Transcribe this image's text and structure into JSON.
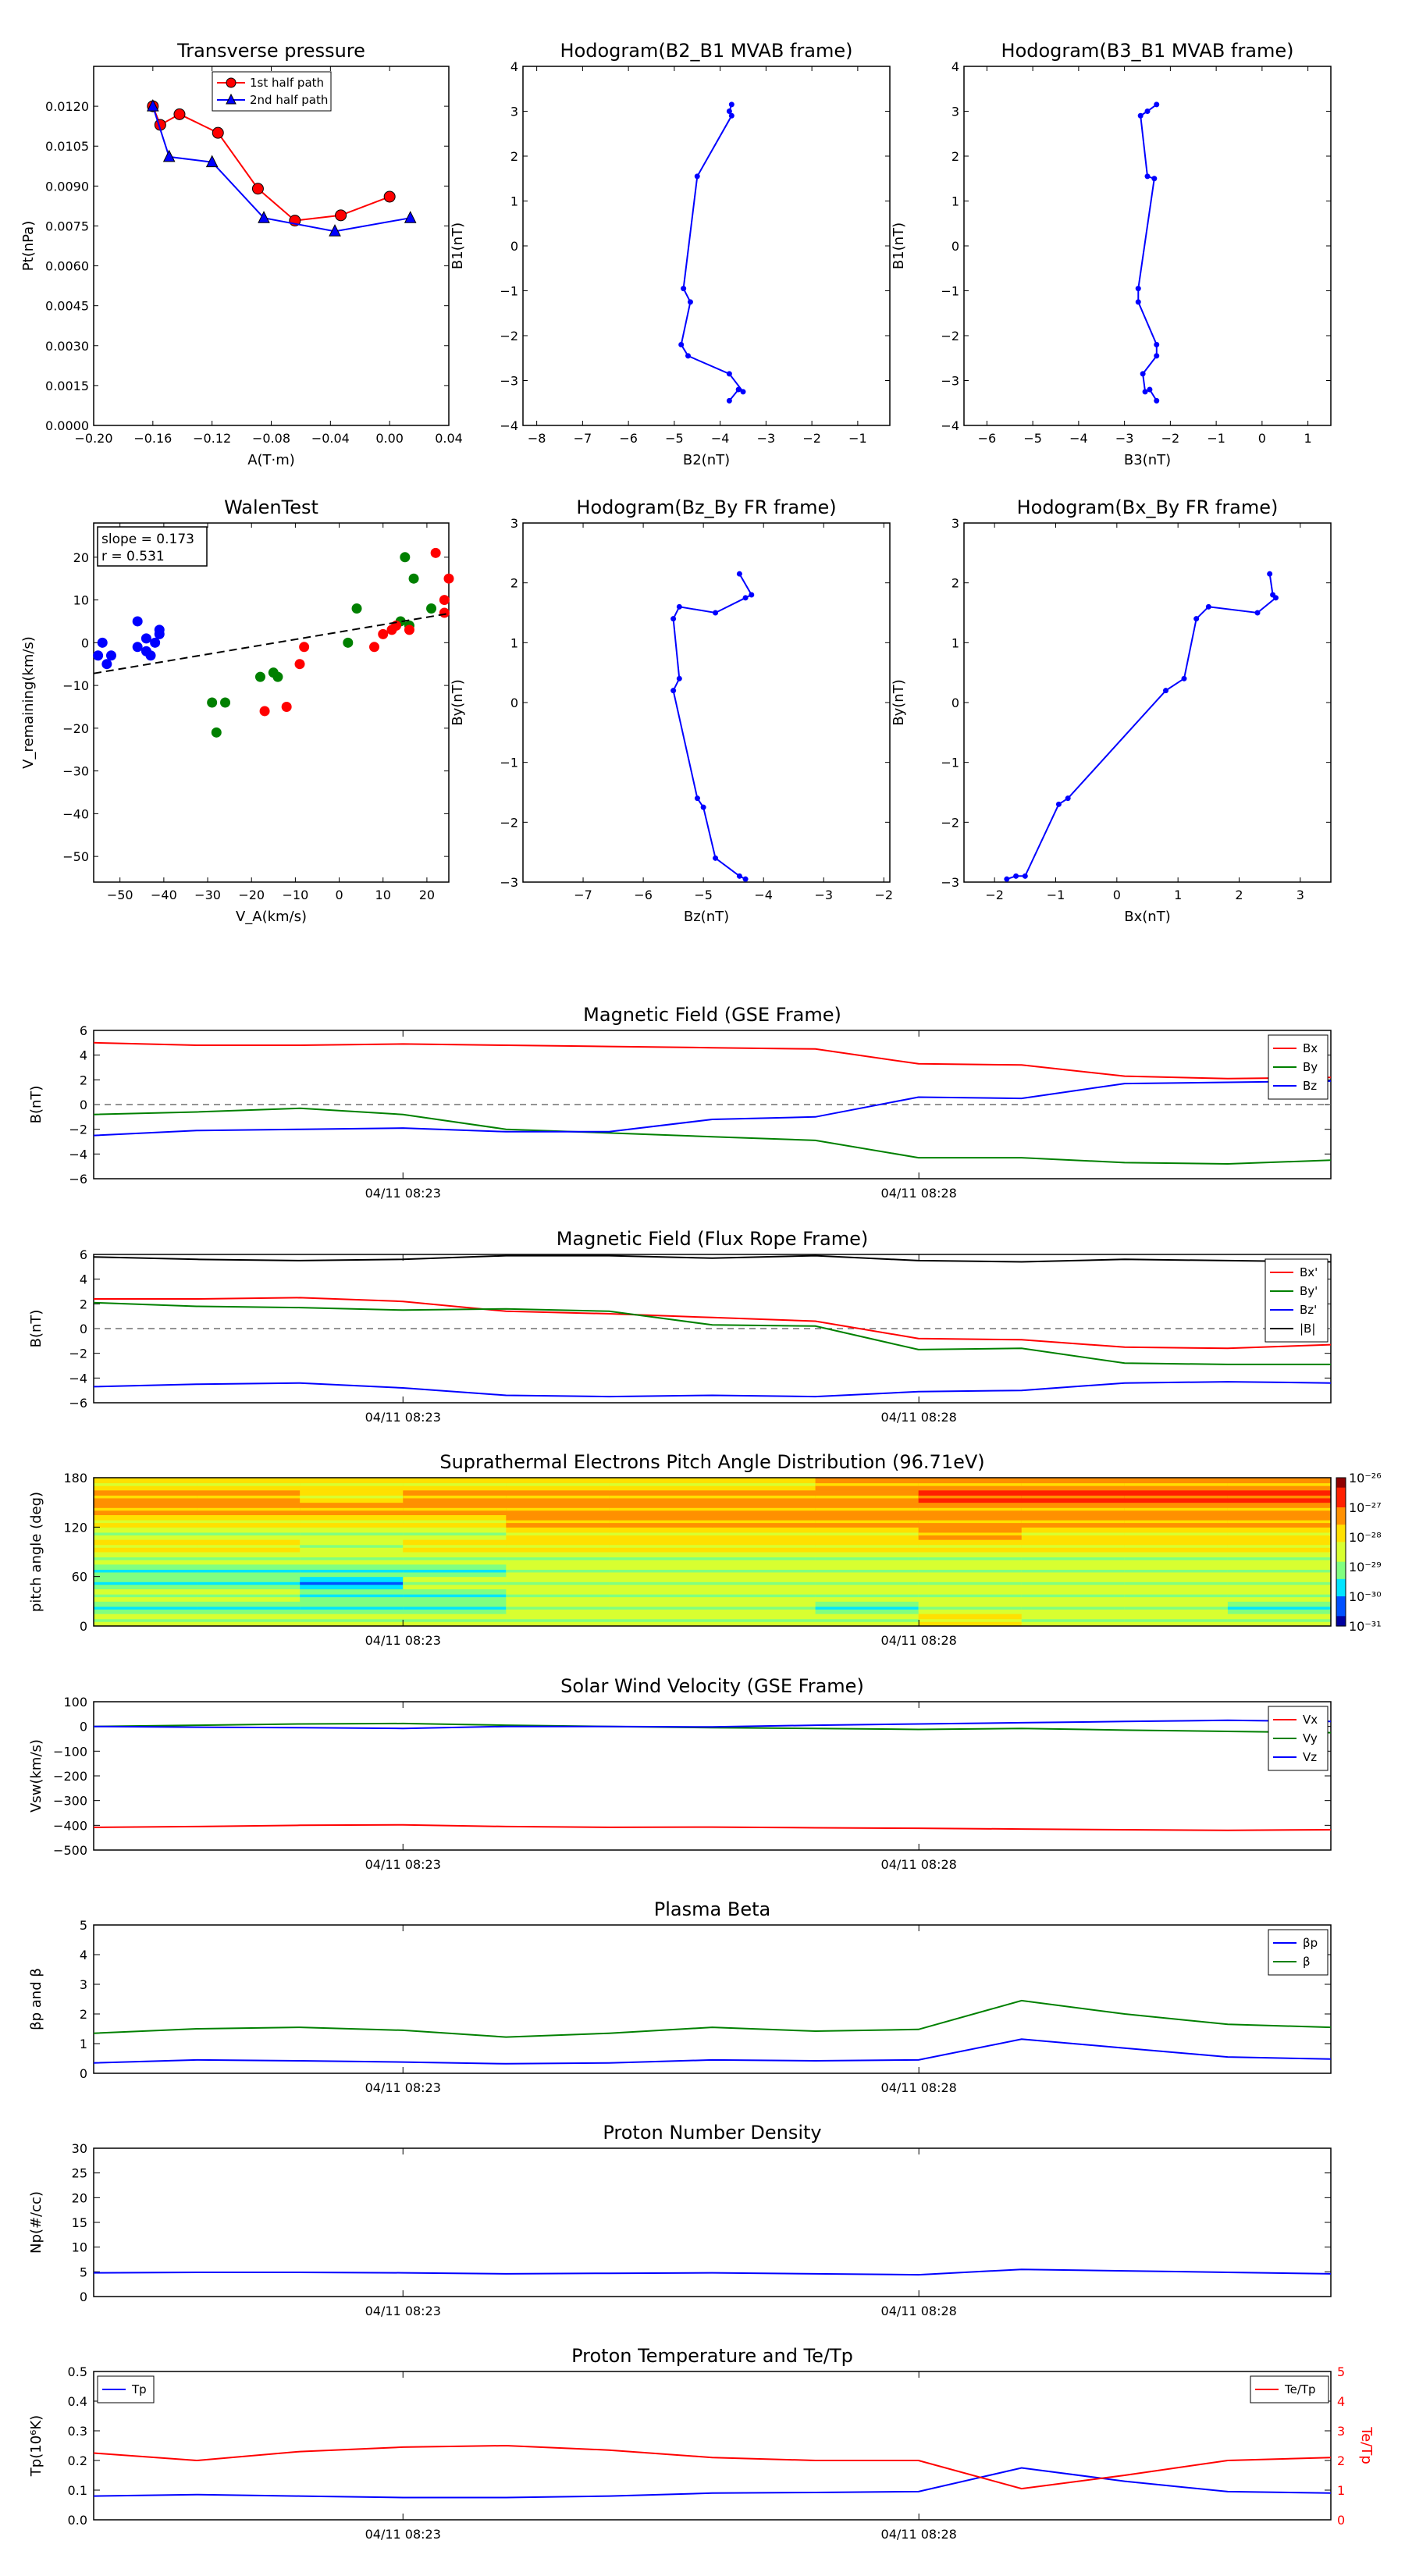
{
  "charts": {
    "transverse_pressure": {
      "type": "line",
      "title": "Transverse pressure",
      "xlabel": "A(T·m)",
      "ylabel": "Pt(nPa)",
      "xlim": [
        -0.2,
        0.04
      ],
      "ylim": [
        0,
        0.0135
      ],
      "xticks": [
        "−0.20",
        "−0.16",
        "−0.12",
        "−0.08",
        "−0.04",
        "0.00",
        "0.04"
      ],
      "yticks": [
        "0.0000",
        "0.0015",
        "0.0030",
        "0.0045",
        "0.0060",
        "0.0075",
        "0.0090",
        "0.0105",
        "0.0120"
      ],
      "legend": "top-center",
      "series": [
        {
          "name": "1st half path",
          "color": "#ff0000",
          "marker": "circle",
          "x": [
            -0.16,
            -0.155,
            -0.142,
            -0.116,
            -0.089,
            -0.064,
            -0.033,
            0.0
          ],
          "y": [
            0.012,
            0.0113,
            0.0117,
            0.011,
            0.0089,
            0.0077,
            0.0079,
            0.0086
          ]
        },
        {
          "name": "2nd half path",
          "color": "#0000ff",
          "marker": "triangle",
          "x": [
            -0.16,
            -0.149,
            -0.12,
            -0.085,
            -0.037,
            0.014
          ],
          "y": [
            0.012,
            0.0101,
            0.0099,
            0.0078,
            0.0073,
            0.0078
          ]
        }
      ]
    },
    "hodo_b2_b1": {
      "type": "line",
      "title": "Hodogram(B2_B1 MVAB frame)",
      "xlabel": "B2(nT)",
      "ylabel": "B1(nT)",
      "xlim": [
        -8.3,
        -0.3
      ],
      "ylim": [
        -4,
        4
      ],
      "xticks": [
        "−8",
        "−7",
        "−6",
        "−5",
        "−4",
        "−3",
        "−2",
        "−1"
      ],
      "yticks": [
        "−4",
        "−3",
        "−2",
        "−1",
        "0",
        "1",
        "2",
        "3",
        "4"
      ],
      "series": [
        {
          "color": "#0000ff",
          "x": [
            -3.75,
            -3.8,
            -3.75,
            -4.5,
            -4.8,
            -4.65,
            -4.85,
            -4.7,
            -3.8,
            -3.5,
            -3.6,
            -3.8
          ],
          "y": [
            3.15,
            3.0,
            2.9,
            1.55,
            -0.95,
            -1.25,
            -2.2,
            -2.45,
            -2.85,
            -3.25,
            -3.2,
            -3.45
          ]
        }
      ]
    },
    "hodo_b3_b1": {
      "type": "line",
      "title": "Hodogram(B3_B1 MVAB frame)",
      "xlabel": "B3(nT)",
      "ylabel": "B1(nT)",
      "xlim": [
        -6.5,
        1.5
      ],
      "ylim": [
        -4,
        4
      ],
      "xticks": [
        "−6",
        "−5",
        "−4",
        "−3",
        "−2",
        "−1",
        "0",
        "1"
      ],
      "yticks": [
        "−4",
        "−3",
        "−2",
        "−1",
        "0",
        "1",
        "2",
        "3",
        "4"
      ],
      "series": [
        {
          "color": "#0000ff",
          "x": [
            -2.3,
            -2.5,
            -2.65,
            -2.5,
            -2.35,
            -2.7,
            -2.7,
            -2.3,
            -2.3,
            -2.6,
            -2.55,
            -2.45,
            -2.3
          ],
          "y": [
            3.15,
            3.0,
            2.9,
            1.55,
            1.5,
            -0.95,
            -1.25,
            -2.2,
            -2.45,
            -2.85,
            -3.25,
            -3.2,
            -3.45
          ]
        }
      ]
    },
    "walen": {
      "type": "scatter",
      "title": "WalenTest",
      "xlabel": "V_A(km/s)",
      "ylabel": "V_remaining(km/s)",
      "xlim": [
        -56,
        25
      ],
      "ylim": [
        -56,
        28
      ],
      "xticks": [
        "−50",
        "−40",
        "−30",
        "−20",
        "−10",
        "0",
        "10",
        "20"
      ],
      "yticks": [
        "−50",
        "−40",
        "−30",
        "−20",
        "−10",
        "0",
        "10",
        "20"
      ],
      "annotation": [
        "slope = 0.173",
        "r = 0.531"
      ],
      "fit": {
        "slope": 0.173,
        "intercept": 2.5
      },
      "series": [
        {
          "color": "#0000ff",
          "x": [
            -54,
            -55,
            -53,
            -52,
            -46,
            -46,
            -44,
            -44,
            -43,
            -42,
            -41,
            -41
          ],
          "y": [
            0,
            -3,
            -5,
            -3,
            5,
            -1,
            1,
            -2,
            -3,
            0,
            2,
            3
          ]
        },
        {
          "color": "#008000",
          "x": [
            -29,
            -28,
            -26,
            -18,
            -15,
            -14,
            2,
            4,
            14,
            15,
            16,
            17,
            21
          ],
          "y": [
            -14,
            -21,
            -14,
            -8,
            -7,
            -8,
            0,
            8,
            5,
            20,
            4,
            15,
            8
          ]
        },
        {
          "color": "#ff0000",
          "x": [
            -17,
            -12,
            -9,
            -8,
            8,
            10,
            12,
            13,
            16,
            22,
            24,
            24,
            25
          ],
          "y": [
            -16,
            -15,
            -5,
            -1,
            -1,
            2,
            3,
            4,
            3,
            21,
            10,
            7,
            15
          ]
        }
      ]
    },
    "hodo_bz_by": {
      "type": "line",
      "title": "Hodogram(Bz_By FR frame)",
      "xlabel": "Bz(nT)",
      "ylabel": "By(nT)",
      "xlim": [
        -8,
        -1.9
      ],
      "ylim": [
        -3,
        3
      ],
      "xticks": [
        "−7",
        "−6",
        "−5",
        "−4",
        "−3",
        "−2"
      ],
      "yticks": [
        "−3",
        "−2",
        "−1",
        "0",
        "1",
        "2",
        "3"
      ],
      "series": [
        {
          "color": "#0000ff",
          "x": [
            -4.4,
            -4.2,
            -4.3,
            -4.8,
            -5.4,
            -5.5,
            -5.4,
            -5.5,
            -5.1,
            -5.0,
            -4.8,
            -4.4,
            -4.3
          ],
          "y": [
            2.15,
            1.8,
            1.75,
            1.5,
            1.6,
            1.4,
            0.4,
            0.2,
            -1.6,
            -1.75,
            -2.6,
            -2.9,
            -2.95
          ]
        }
      ]
    },
    "hodo_bx_by": {
      "type": "line",
      "title": "Hodogram(Bx_By FR frame)",
      "xlabel": "Bx(nT)",
      "ylabel": "By(nT)",
      "xlim": [
        -2.5,
        3.5
      ],
      "ylim": [
        -3,
        3
      ],
      "xticks": [
        "−2",
        "−1",
        "0",
        "1",
        "2",
        "3"
      ],
      "yticks": [
        "−3",
        "−2",
        "−1",
        "0",
        "1",
        "2",
        "3"
      ],
      "series": [
        {
          "color": "#0000ff",
          "x": [
            2.5,
            2.55,
            2.6,
            2.3,
            1.5,
            1.3,
            1.1,
            0.8,
            -0.8,
            -0.95,
            -1.5,
            -1.65,
            -1.8
          ],
          "y": [
            2.15,
            1.8,
            1.75,
            1.5,
            1.6,
            1.4,
            0.4,
            0.2,
            -1.6,
            -1.7,
            -2.9,
            -2.9,
            -2.95
          ]
        }
      ]
    },
    "mag_gse": {
      "type": "line",
      "title": "Magnetic Field (GSE Frame)",
      "ylabel": "B(nT)",
      "ylim": [
        -6,
        6
      ],
      "yticks": [
        "−6",
        "−4",
        "−2",
        "0",
        "2",
        "4",
        "6"
      ],
      "xticks": [
        "04/11 08:23",
        "04/11 08:28"
      ],
      "legend": "top-right",
      "zero_line": true,
      "series": [
        {
          "name": "Bx",
          "color": "#ff0000",
          "values": [
            5.0,
            4.8,
            4.8,
            4.9,
            4.8,
            4.7,
            4.6,
            4.5,
            3.3,
            3.2,
            2.3,
            2.1,
            2.2
          ]
        },
        {
          "name": "By",
          "color": "#008000",
          "values": [
            -0.8,
            -0.6,
            -0.3,
            -0.8,
            -2.0,
            -2.3,
            -2.6,
            -2.9,
            -4.3,
            -4.3,
            -4.7,
            -4.8,
            -4.5
          ]
        },
        {
          "name": "Bz",
          "color": "#0000ff",
          "values": [
            -2.5,
            -2.1,
            -2.0,
            -1.9,
            -2.2,
            -2.2,
            -1.2,
            -1.0,
            0.6,
            0.5,
            1.7,
            1.8,
            1.9
          ]
        }
      ]
    },
    "mag_fr": {
      "type": "line",
      "title": "Magnetic Field (Flux Rope Frame)",
      "ylabel": "B(nT)",
      "ylim": [
        -6,
        6
      ],
      "yticks": [
        "−6",
        "−4",
        "−2",
        "0",
        "2",
        "4",
        "6"
      ],
      "xticks": [
        "04/11 08:23",
        "04/11 08:28"
      ],
      "legend": "top-right",
      "zero_line": true,
      "series": [
        {
          "name": "Bx'",
          "color": "#ff0000",
          "values": [
            2.4,
            2.4,
            2.5,
            2.2,
            1.4,
            1.2,
            0.9,
            0.6,
            -0.8,
            -0.9,
            -1.5,
            -1.6,
            -1.3
          ]
        },
        {
          "name": "By'",
          "color": "#008000",
          "values": [
            2.1,
            1.8,
            1.7,
            1.5,
            1.6,
            1.4,
            0.3,
            0.2,
            -1.7,
            -1.6,
            -2.8,
            -2.9,
            -2.9
          ]
        },
        {
          "name": "Bz'",
          "color": "#0000ff",
          "values": [
            -4.7,
            -4.5,
            -4.4,
            -4.8,
            -5.4,
            -5.5,
            -5.4,
            -5.5,
            -5.1,
            -5.0,
            -4.4,
            -4.3,
            -4.4
          ]
        },
        {
          "name": "|B|",
          "color": "#000000",
          "values": [
            5.8,
            5.6,
            5.5,
            5.6,
            5.9,
            5.9,
            5.7,
            5.9,
            5.5,
            5.4,
            5.6,
            5.5,
            5.4
          ]
        }
      ]
    },
    "pad": {
      "type": "heatmap",
      "title": "Suprathermal Electrons Pitch Angle Distribution (96.71eV)",
      "ylabel": "pitch angle (deg)",
      "ylim": [
        0,
        180
      ],
      "yticks": [
        "0",
        "60",
        "120",
        "180"
      ],
      "xticks": [
        "04/11 08:23",
        "04/11 08:28"
      ],
      "colorbar": [
        "10⁻²⁶",
        "10⁻²⁷",
        "10⁻²⁸",
        "10⁻²⁹",
        "10⁻³⁰",
        "10⁻³¹"
      ],
      "columns": 12,
      "rows": 12,
      "levels": [
        [
          0.5,
          0.45,
          0.5,
          0.45,
          0.55,
          0.55,
          0.55,
          0.55,
          0.6,
          0.55,
          0.55,
          0.55
        ],
        [
          0.4,
          0.4,
          0.35,
          0.4,
          0.45,
          0.5,
          0.5,
          0.35,
          0.5,
          0.45,
          0.45,
          0.4
        ],
        [
          0.45,
          0.45,
          0.4,
          0.4,
          0.5,
          0.55,
          0.5,
          0.45,
          0.5,
          0.5,
          0.5,
          0.5
        ],
        [
          0.4,
          0.4,
          0.3,
          0.45,
          0.45,
          0.5,
          0.45,
          0.5,
          0.55,
          0.55,
          0.5,
          0.5
        ],
        [
          0.35,
          0.4,
          0.4,
          0.4,
          0.5,
          0.45,
          0.45,
          0.45,
          0.5,
          0.5,
          0.5,
          0.5
        ],
        [
          0.45,
          0.45,
          0.45,
          0.45,
          0.55,
          0.55,
          0.55,
          0.5,
          0.55,
          0.55,
          0.55,
          0.55
        ],
        [
          0.6,
          0.6,
          0.55,
          0.6,
          0.6,
          0.6,
          0.65,
          0.6,
          0.65,
          0.65,
          0.6,
          0.6
        ],
        [
          0.55,
          0.55,
          0.5,
          0.55,
          0.6,
          0.65,
          0.65,
          0.6,
          0.7,
          0.65,
          0.6,
          0.6
        ],
        [
          0.65,
          0.65,
          0.65,
          0.65,
          0.75,
          0.75,
          0.7,
          0.7,
          0.75,
          0.75,
          0.75,
          0.75
        ],
        [
          0.75,
          0.75,
          0.7,
          0.7,
          0.8,
          0.8,
          0.8,
          0.75,
          0.8,
          0.8,
          0.8,
          0.8
        ],
        [
          0.7,
          0.7,
          0.65,
          0.7,
          0.75,
          0.75,
          0.75,
          0.75,
          0.85,
          0.85,
          0.85,
          0.85
        ],
        [
          0.6,
          0.6,
          0.6,
          0.6,
          0.65,
          0.65,
          0.65,
          0.7,
          0.75,
          0.75,
          0.75,
          0.75
        ]
      ]
    },
    "sw_vel": {
      "type": "line",
      "title": "Solar Wind Velocity (GSE Frame)",
      "ylabel": "Vsw(km/s)",
      "ylim": [
        -500,
        100
      ],
      "yticks": [
        "−500",
        "−400",
        "−300",
        "−200",
        "−100",
        "0",
        "100"
      ],
      "xticks": [
        "04/11 08:23",
        "04/11 08:28"
      ],
      "legend": "top-right",
      "series": [
        {
          "name": "Vx",
          "color": "#ff0000",
          "values": [
            -408,
            -405,
            -400,
            -398,
            -405,
            -408,
            -407,
            -410,
            -412,
            -415,
            -418,
            -420,
            -418
          ]
        },
        {
          "name": "Vy",
          "color": "#008000",
          "values": [
            0,
            5,
            10,
            12,
            5,
            0,
            -5,
            -8,
            -12,
            -8,
            -15,
            -20,
            -25
          ]
        },
        {
          "name": "Vz",
          "color": "#0000ff",
          "values": [
            0,
            -3,
            -5,
            -8,
            0,
            0,
            -2,
            5,
            10,
            15,
            20,
            25,
            20
          ]
        }
      ]
    },
    "beta": {
      "type": "line",
      "title": "Plasma Beta",
      "ylabel": "βp and β",
      "ylim": [
        0,
        5
      ],
      "yticks": [
        "0",
        "1",
        "2",
        "3",
        "4",
        "5"
      ],
      "xticks": [
        "04/11 08:23",
        "04/11 08:28"
      ],
      "legend": "top-right",
      "series": [
        {
          "name": "βp",
          "color": "#0000ff",
          "values": [
            0.35,
            0.45,
            0.42,
            0.38,
            0.32,
            0.35,
            0.45,
            0.42,
            0.45,
            1.15,
            0.85,
            0.55,
            0.48
          ]
        },
        {
          "name": "β",
          "color": "#008000",
          "values": [
            1.35,
            1.5,
            1.55,
            1.45,
            1.22,
            1.35,
            1.55,
            1.42,
            1.48,
            2.45,
            2.0,
            1.65,
            1.55
          ]
        }
      ]
    },
    "density": {
      "type": "line",
      "title": "Proton Number Density",
      "ylabel": "Np(#/cc)",
      "ylim": [
        0,
        30
      ],
      "yticks": [
        "0",
        "5",
        "10",
        "15",
        "20",
        "25",
        "30"
      ],
      "xticks": [
        "04/11 08:23",
        "04/11 08:28"
      ],
      "series": [
        {
          "name": "Np",
          "color": "#0000ff",
          "values": [
            4.8,
            4.9,
            4.9,
            4.8,
            4.6,
            4.7,
            4.8,
            4.6,
            4.4,
            5.5,
            5.2,
            4.9,
            4.6
          ]
        }
      ]
    },
    "temp": {
      "type": "line",
      "title": "Proton Temperature and Te/Tp",
      "ylabel": "Tp(10⁶K)",
      "y2label": "Te/Tp",
      "ylim": [
        0,
        0.5
      ],
      "yticks": [
        "0.0",
        "0.1",
        "0.2",
        "0.3",
        "0.4",
        "0.5"
      ],
      "y2lim": [
        0,
        5
      ],
      "y2ticks": [
        "0",
        "1",
        "2",
        "3",
        "4",
        "5"
      ],
      "xticks": [
        "04/11 08:23",
        "04/11 08:28"
      ],
      "series": [
        {
          "name": "Tp",
          "color": "#0000ff",
          "axis": "left",
          "values": [
            0.08,
            0.085,
            0.08,
            0.075,
            0.075,
            0.08,
            0.09,
            0.092,
            0.095,
            0.175,
            0.13,
            0.095,
            0.09
          ]
        },
        {
          "name": "Te/Tp",
          "color": "#ff0000",
          "axis": "right",
          "values": [
            2.25,
            2.0,
            2.3,
            2.45,
            2.5,
            2.35,
            2.1,
            2.0,
            2.0,
            1.05,
            1.5,
            2.0,
            2.1
          ]
        }
      ]
    }
  }
}
